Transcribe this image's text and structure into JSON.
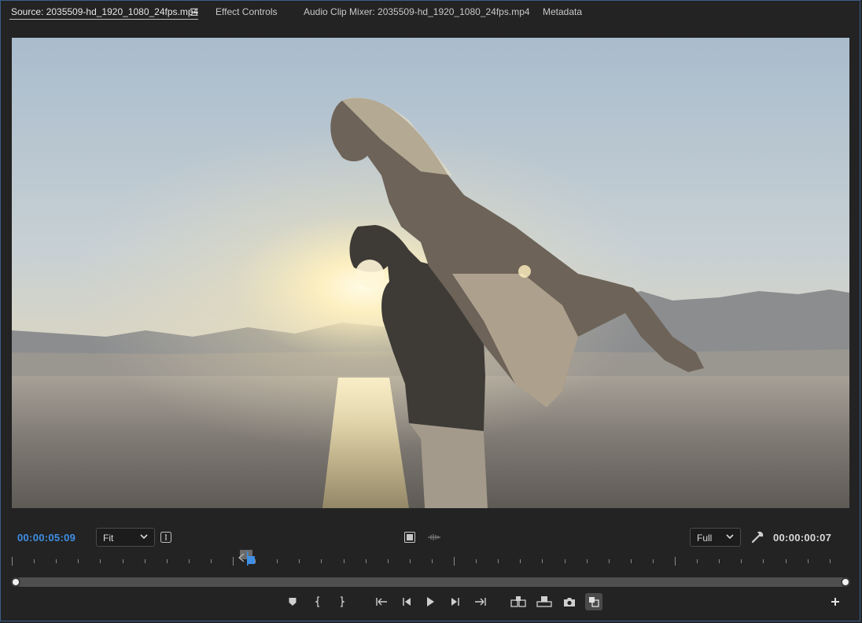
{
  "tabs": [
    {
      "label": "Source: 2035509-hd_1920_1080_24fps.mp4",
      "active": true
    },
    {
      "label": "Effect Controls",
      "active": false
    },
    {
      "label": "Audio Clip Mixer: 2035509-hd_1920_1080_24fps.mp4",
      "active": false
    },
    {
      "label": "Metadata",
      "active": false
    }
  ],
  "panel_menu_icon": "hamburger-icon",
  "video": {
    "content": "silhouette of a man lifting a woman on a lake shore at sunset"
  },
  "controls": {
    "current_timecode": "00:00:05:09",
    "zoom_select": {
      "value": "Fit"
    },
    "resolution_select": {
      "value": "Full"
    },
    "duration_timecode": "00:00:00:07",
    "accent_color": "#3f8fe6"
  },
  "transport_buttons": [
    {
      "name": "add-marker",
      "icon": "marker-icon"
    },
    {
      "name": "mark-in",
      "icon": "mark-in-icon"
    },
    {
      "name": "mark-out",
      "icon": "mark-out-icon"
    },
    {
      "name": "go-to-in",
      "icon": "go-to-in-icon"
    },
    {
      "name": "step-back",
      "icon": "step-back-icon"
    },
    {
      "name": "play",
      "icon": "play-icon"
    },
    {
      "name": "step-forward",
      "icon": "step-forward-icon"
    },
    {
      "name": "go-to-out",
      "icon": "go-to-out-icon"
    },
    {
      "name": "insert",
      "icon": "insert-icon"
    },
    {
      "name": "overwrite",
      "icon": "overwrite-icon"
    },
    {
      "name": "export-frame",
      "icon": "camera-icon"
    },
    {
      "name": "button-editor-toggle",
      "icon": "comparison-icon",
      "active": true
    },
    {
      "name": "button-editor",
      "icon": "plus-icon"
    }
  ]
}
